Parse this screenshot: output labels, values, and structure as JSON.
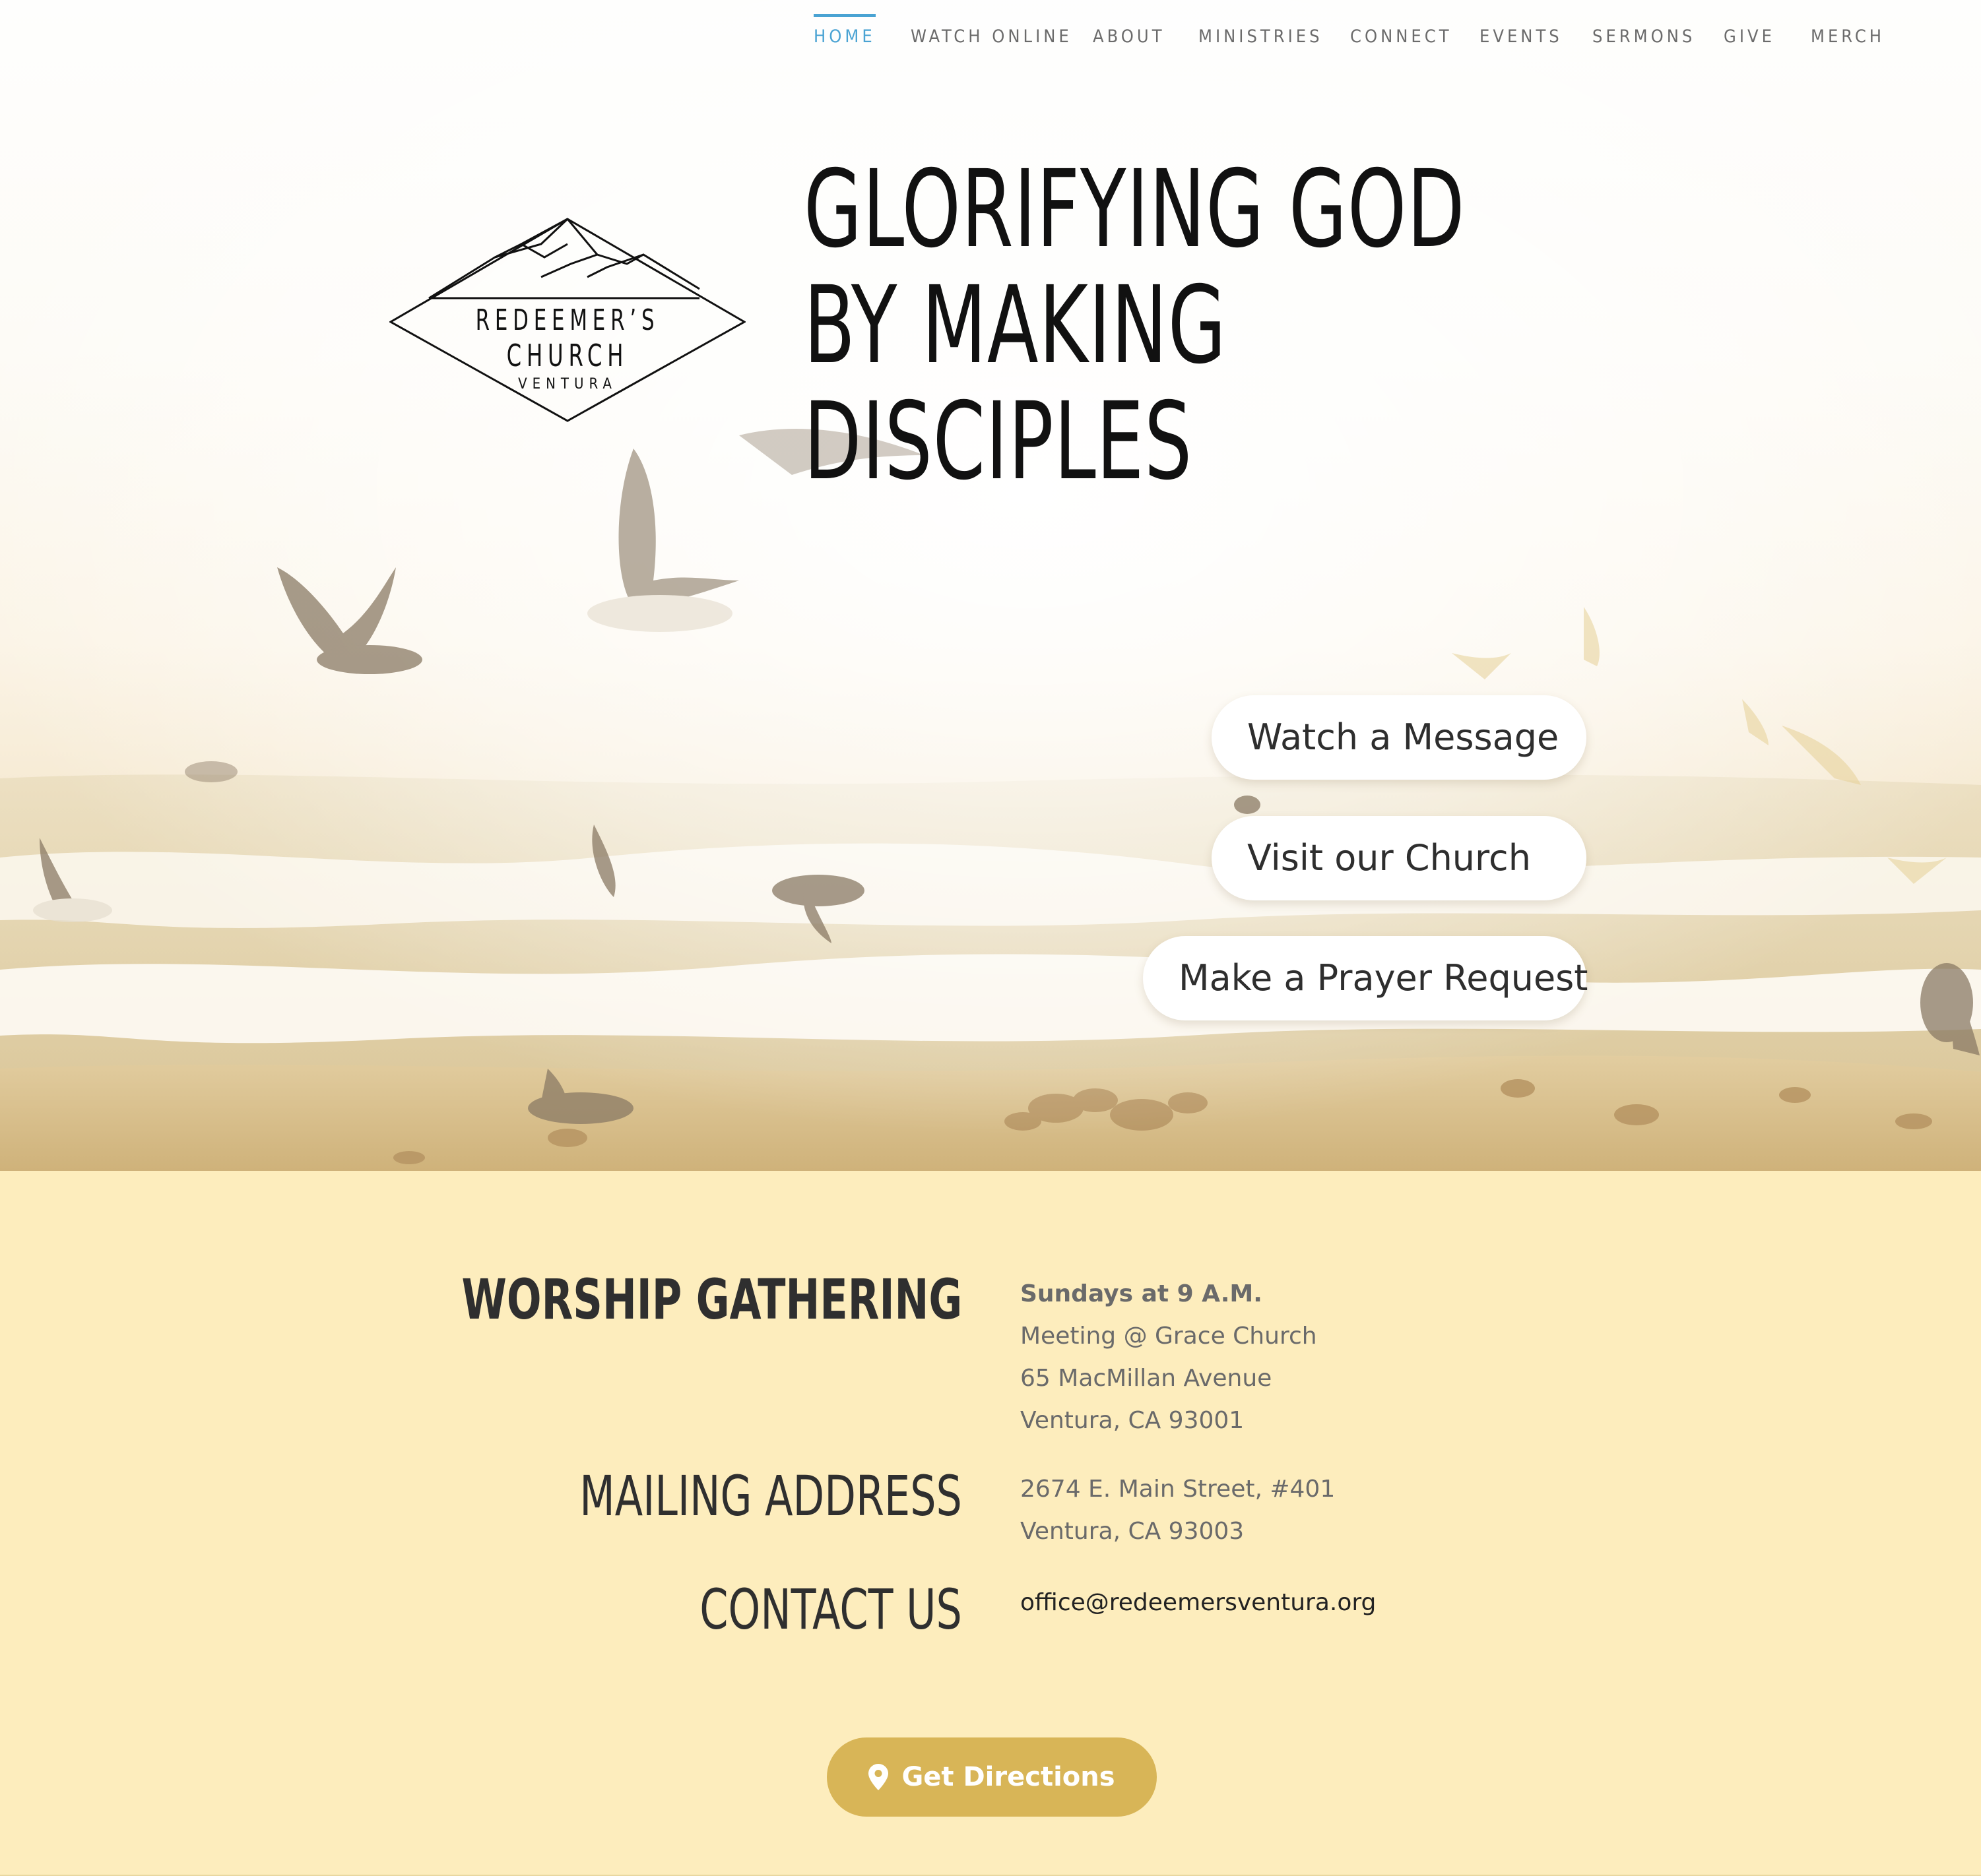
{
  "nav": {
    "items": [
      {
        "label": "HOME",
        "active": true
      },
      {
        "label": "WATCH ONLINE",
        "active": false
      },
      {
        "label": "ABOUT",
        "active": false
      },
      {
        "label": "MINISTRIES",
        "active": false
      },
      {
        "label": "CONNECT",
        "active": false
      },
      {
        "label": "EVENTS",
        "active": false
      },
      {
        "label": "SERMONS",
        "active": false
      },
      {
        "label": "GIVE",
        "active": false
      },
      {
        "label": "MERCH",
        "active": false
      }
    ],
    "active_color": "#4aa3d3"
  },
  "logo": {
    "line1": "REDEEMER’S",
    "line2": "CHURCH",
    "line3": "VENTURA"
  },
  "hero": {
    "headline": [
      "GLORIFYING GOD",
      "BY MAKING",
      "DISCIPLES"
    ],
    "buttons": [
      "Watch a Message",
      "Visit our Church",
      "Make a Prayer Request"
    ]
  },
  "info": {
    "worship": {
      "heading": "WORSHIP GATHERING",
      "time": "Sundays at 9 A.M.",
      "lines": [
        "Meeting @ Grace Church",
        "65 MacMillan Avenue",
        "Ventura, CA 93001"
      ]
    },
    "mailing": {
      "heading": "MAILING ADDRESS",
      "lines": [
        "2674 E. Main Street, #401",
        "Ventura, CA 93003"
      ]
    },
    "contact": {
      "heading": "CONTACT US",
      "email": "office@redeemersventura.org"
    },
    "directions_label": "Get Directions",
    "section_color": "#fdedbd",
    "button_color": "#d8b557"
  },
  "icons": {
    "directions": "map-pin-icon"
  }
}
